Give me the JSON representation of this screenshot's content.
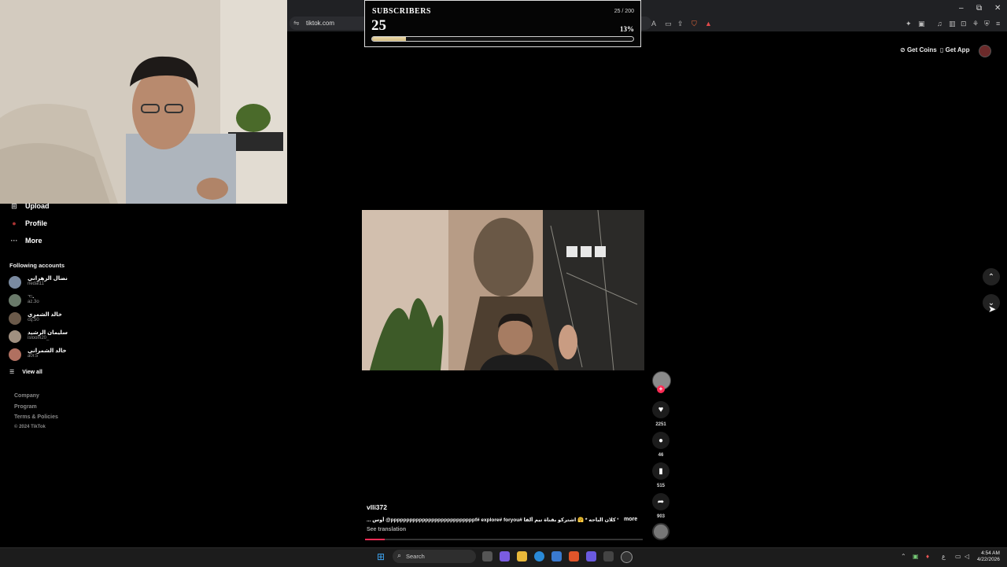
{
  "browser": {
    "url": "tiktok.com",
    "lock_icon": "site-info-icon"
  },
  "overlay": {
    "title": "SUBSCRIBERS",
    "goal_text": "25 / 200",
    "count": "25",
    "percent_text": "13%",
    "progress_fraction": 0.13
  },
  "header": {
    "get_coins": "Get Coins",
    "get_app": "Get App"
  },
  "sidebar": {
    "upload": "Upload",
    "profile": "Profile",
    "more": "More",
    "following_title": "Following accounts",
    "accounts": [
      {
        "name": "نضال الزهراني",
        "handle": "nedal11",
        "color": "#7a8aa0"
      },
      {
        "name": "☜.",
        "handle": "az.3o",
        "color": "#6a7a6a"
      },
      {
        "name": "خالد الشمري",
        "handle": "cq.50",
        "color": "#6b5a4a"
      },
      {
        "name": "سليمان الرشيد",
        "handle": "isloom20_",
        "color": "#a09080"
      },
      {
        "name": "خالد الشمراني",
        "handle": "a0r.5",
        "color": "#b07060"
      }
    ],
    "view_all": "View all",
    "footer": [
      "Company",
      "Program",
      "Terms & Policies",
      "© 2024 TikTok"
    ]
  },
  "video": {
    "author": "vlli372",
    "caption": "... أوس @pppppppppppppppppppppppppppf# explore# foryou# كلان الباحه * 🤗 اشتركو بقناة تيم ألفا *",
    "more": "more",
    "see_translation": "See translation",
    "likes": "2251",
    "comments": "46",
    "saves": "515",
    "shares": "903",
    "progress_fraction": 0.07
  },
  "taskbar": {
    "search": "Search",
    "lang": "ع",
    "time": "4:54 AM",
    "date": "4/22/2026"
  },
  "colors": {
    "accent": "#fe2c55",
    "bar_fill": "#d4bc82"
  }
}
